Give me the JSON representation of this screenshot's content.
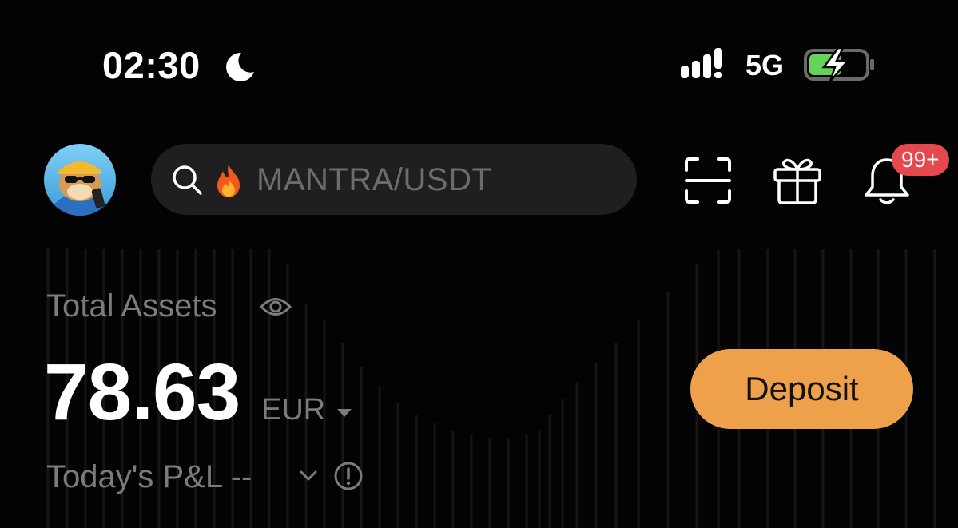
{
  "status_bar": {
    "time": "02:30",
    "network": "5G",
    "icons": [
      "moon-icon",
      "signal-icon",
      "battery-charging-icon"
    ]
  },
  "header": {
    "search": {
      "placeholder": "MANTRA/USDT",
      "icon": "flame-icon"
    },
    "notifications": {
      "badge": "99+"
    },
    "icons": [
      "avatar",
      "search-icon",
      "scan-icon",
      "gift-icon",
      "bell-icon"
    ]
  },
  "assets": {
    "label": "Total Assets",
    "value": "78.63",
    "currency": "EUR",
    "pnl_label": "Today's P&L --",
    "deposit_label": "Deposit"
  },
  "colors": {
    "background": "#030303",
    "search_bg": "#1f1f22",
    "muted_text": "#7a7a7f",
    "deposit": "#eea14a",
    "badge": "#e5484d",
    "battery": "#65d25a"
  }
}
